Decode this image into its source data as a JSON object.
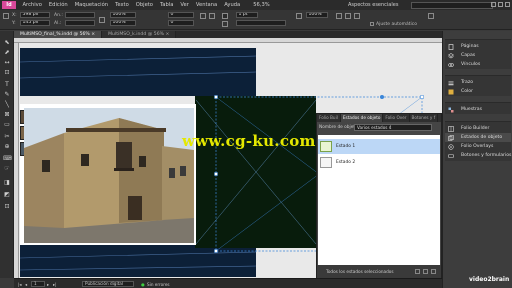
{
  "app": {
    "logo": "Id",
    "menus": [
      "Archivo",
      "Edición",
      "Maquetación",
      "Texto",
      "Objeto",
      "Tabla",
      "Ver",
      "Ventana",
      "Ayuda"
    ],
    "zoom": "56,3%",
    "workspace": "Aspectos esenciales"
  },
  "controlbar": {
    "x_label": "X:",
    "x_value": "598 px",
    "y_label": "Y:",
    "y_value": "145 px",
    "w_label": "An.:",
    "w_value": "",
    "h_label": "Al.:",
    "h_value": "",
    "scale_x": "100%",
    "scale_y": "100%",
    "rotation": "0°",
    "shear": "0°",
    "stroke_weight": "1 pt",
    "frame_pct": "100%",
    "auto_fit_label": "Ajuste automático"
  },
  "tabs": [
    {
      "label": "MultiMSO_final_%.indd @ 56% ×",
      "active": true
    },
    {
      "label": "MultiMSO_k.indd @ 56% ×",
      "active": false
    }
  ],
  "tools": [
    "⬉",
    "⬈",
    "↔",
    "⊡",
    "T",
    "✎",
    "╲",
    "⊠",
    "▭",
    "✂",
    "⊕",
    "⌨",
    "☞",
    "◨",
    "◩",
    "⊡"
  ],
  "watermark": "www.cg-ku.com",
  "float_panel": {
    "tabs": [
      "Folio Buil",
      "Estados de objeto",
      "Folio Over",
      "Botones y f"
    ],
    "name_label": "Nombre de objeto:",
    "name_value": "Varios estados 4",
    "states": [
      {
        "name": "Estado 1",
        "selected": true
      },
      {
        "name": "Estado 2",
        "selected": false
      }
    ],
    "footer": "Todos los estados seleccionados"
  },
  "right_panel": {
    "groups": [
      [
        {
          "label": "Páginas",
          "icon": "pages-icon",
          "color": "#d9d9d9"
        },
        {
          "label": "Capas",
          "icon": "layers-icon",
          "color": "#d9d9d9"
        },
        {
          "label": "Vínculos",
          "icon": "links-icon",
          "color": "#d9d9d9"
        }
      ],
      [
        {
          "label": "Trazo",
          "icon": "stroke-icon",
          "color": "#d9d9d9"
        },
        {
          "label": "Color",
          "icon": "color-icon",
          "color": "#e0b040"
        }
      ],
      [
        {
          "label": "Muestras",
          "icon": "swatches-icon",
          "color": "#8fb8e0"
        }
      ],
      [
        {
          "label": "Folio Builder",
          "icon": "folio-builder-icon",
          "color": "#d9d9d9"
        },
        {
          "label": "Estados de objeto",
          "icon": "object-states-icon",
          "color": "#d9d9d9",
          "selected": true
        },
        {
          "label": "Folio Overlays",
          "icon": "folio-overlays-icon",
          "color": "#d9d9d9"
        },
        {
          "label": "Botones y formularios",
          "icon": "buttons-forms-icon",
          "color": "#d9d9d9"
        }
      ]
    ]
  },
  "status": {
    "page": "1",
    "preview": "Publicación digital",
    "errors": "Sin errores"
  },
  "brand": "video2brain"
}
